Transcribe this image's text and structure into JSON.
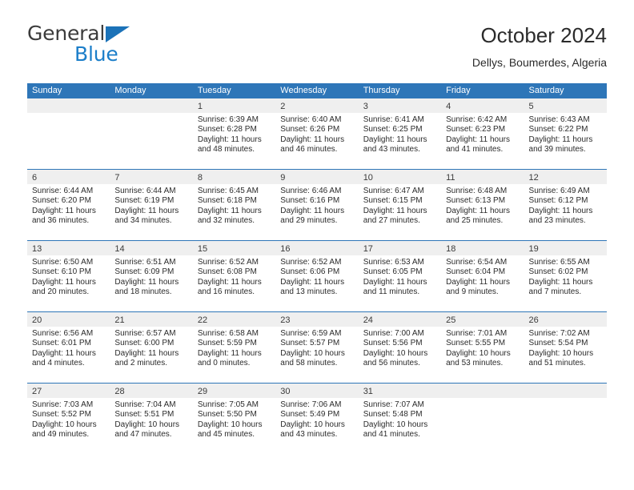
{
  "logo": {
    "word1": "General",
    "word2": "Blue",
    "triangle_icon": "logo-triangle-icon",
    "color_word1": "#3b3b3b",
    "color_word2": "#1b7ec9",
    "color_triangle": "#1b72b8"
  },
  "header": {
    "title": "October 2024",
    "subtitle": "Dellys, Boumerdes, Algeria"
  },
  "theme": {
    "header_blue": "#2e76b8",
    "day_band_gray": "#efefef",
    "text": "#2b2b2b"
  },
  "weekdays": [
    "Sunday",
    "Monday",
    "Tuesday",
    "Wednesday",
    "Thursday",
    "Friday",
    "Saturday"
  ],
  "weeks": [
    [
      {
        "day": "",
        "sunrise": "",
        "sunset": "",
        "daylight_line1": "",
        "daylight_line2": ""
      },
      {
        "day": "",
        "sunrise": "",
        "sunset": "",
        "daylight_line1": "",
        "daylight_line2": ""
      },
      {
        "day": "1",
        "sunrise": "Sunrise: 6:39 AM",
        "sunset": "Sunset: 6:28 PM",
        "daylight_line1": "Daylight: 11 hours",
        "daylight_line2": "and 48 minutes."
      },
      {
        "day": "2",
        "sunrise": "Sunrise: 6:40 AM",
        "sunset": "Sunset: 6:26 PM",
        "daylight_line1": "Daylight: 11 hours",
        "daylight_line2": "and 46 minutes."
      },
      {
        "day": "3",
        "sunrise": "Sunrise: 6:41 AM",
        "sunset": "Sunset: 6:25 PM",
        "daylight_line1": "Daylight: 11 hours",
        "daylight_line2": "and 43 minutes."
      },
      {
        "day": "4",
        "sunrise": "Sunrise: 6:42 AM",
        "sunset": "Sunset: 6:23 PM",
        "daylight_line1": "Daylight: 11 hours",
        "daylight_line2": "and 41 minutes."
      },
      {
        "day": "5",
        "sunrise": "Sunrise: 6:43 AM",
        "sunset": "Sunset: 6:22 PM",
        "daylight_line1": "Daylight: 11 hours",
        "daylight_line2": "and 39 minutes."
      }
    ],
    [
      {
        "day": "6",
        "sunrise": "Sunrise: 6:44 AM",
        "sunset": "Sunset: 6:20 PM",
        "daylight_line1": "Daylight: 11 hours",
        "daylight_line2": "and 36 minutes."
      },
      {
        "day": "7",
        "sunrise": "Sunrise: 6:44 AM",
        "sunset": "Sunset: 6:19 PM",
        "daylight_line1": "Daylight: 11 hours",
        "daylight_line2": "and 34 minutes."
      },
      {
        "day": "8",
        "sunrise": "Sunrise: 6:45 AM",
        "sunset": "Sunset: 6:18 PM",
        "daylight_line1": "Daylight: 11 hours",
        "daylight_line2": "and 32 minutes."
      },
      {
        "day": "9",
        "sunrise": "Sunrise: 6:46 AM",
        "sunset": "Sunset: 6:16 PM",
        "daylight_line1": "Daylight: 11 hours",
        "daylight_line2": "and 29 minutes."
      },
      {
        "day": "10",
        "sunrise": "Sunrise: 6:47 AM",
        "sunset": "Sunset: 6:15 PM",
        "daylight_line1": "Daylight: 11 hours",
        "daylight_line2": "and 27 minutes."
      },
      {
        "day": "11",
        "sunrise": "Sunrise: 6:48 AM",
        "sunset": "Sunset: 6:13 PM",
        "daylight_line1": "Daylight: 11 hours",
        "daylight_line2": "and 25 minutes."
      },
      {
        "day": "12",
        "sunrise": "Sunrise: 6:49 AM",
        "sunset": "Sunset: 6:12 PM",
        "daylight_line1": "Daylight: 11 hours",
        "daylight_line2": "and 23 minutes."
      }
    ],
    [
      {
        "day": "13",
        "sunrise": "Sunrise: 6:50 AM",
        "sunset": "Sunset: 6:10 PM",
        "daylight_line1": "Daylight: 11 hours",
        "daylight_line2": "and 20 minutes."
      },
      {
        "day": "14",
        "sunrise": "Sunrise: 6:51 AM",
        "sunset": "Sunset: 6:09 PM",
        "daylight_line1": "Daylight: 11 hours",
        "daylight_line2": "and 18 minutes."
      },
      {
        "day": "15",
        "sunrise": "Sunrise: 6:52 AM",
        "sunset": "Sunset: 6:08 PM",
        "daylight_line1": "Daylight: 11 hours",
        "daylight_line2": "and 16 minutes."
      },
      {
        "day": "16",
        "sunrise": "Sunrise: 6:52 AM",
        "sunset": "Sunset: 6:06 PM",
        "daylight_line1": "Daylight: 11 hours",
        "daylight_line2": "and 13 minutes."
      },
      {
        "day": "17",
        "sunrise": "Sunrise: 6:53 AM",
        "sunset": "Sunset: 6:05 PM",
        "daylight_line1": "Daylight: 11 hours",
        "daylight_line2": "and 11 minutes."
      },
      {
        "day": "18",
        "sunrise": "Sunrise: 6:54 AM",
        "sunset": "Sunset: 6:04 PM",
        "daylight_line1": "Daylight: 11 hours",
        "daylight_line2": "and 9 minutes."
      },
      {
        "day": "19",
        "sunrise": "Sunrise: 6:55 AM",
        "sunset": "Sunset: 6:02 PM",
        "daylight_line1": "Daylight: 11 hours",
        "daylight_line2": "and 7 minutes."
      }
    ],
    [
      {
        "day": "20",
        "sunrise": "Sunrise: 6:56 AM",
        "sunset": "Sunset: 6:01 PM",
        "daylight_line1": "Daylight: 11 hours",
        "daylight_line2": "and 4 minutes."
      },
      {
        "day": "21",
        "sunrise": "Sunrise: 6:57 AM",
        "sunset": "Sunset: 6:00 PM",
        "daylight_line1": "Daylight: 11 hours",
        "daylight_line2": "and 2 minutes."
      },
      {
        "day": "22",
        "sunrise": "Sunrise: 6:58 AM",
        "sunset": "Sunset: 5:59 PM",
        "daylight_line1": "Daylight: 11 hours",
        "daylight_line2": "and 0 minutes."
      },
      {
        "day": "23",
        "sunrise": "Sunrise: 6:59 AM",
        "sunset": "Sunset: 5:57 PM",
        "daylight_line1": "Daylight: 10 hours",
        "daylight_line2": "and 58 minutes."
      },
      {
        "day": "24",
        "sunrise": "Sunrise: 7:00 AM",
        "sunset": "Sunset: 5:56 PM",
        "daylight_line1": "Daylight: 10 hours",
        "daylight_line2": "and 56 minutes."
      },
      {
        "day": "25",
        "sunrise": "Sunrise: 7:01 AM",
        "sunset": "Sunset: 5:55 PM",
        "daylight_line1": "Daylight: 10 hours",
        "daylight_line2": "and 53 minutes."
      },
      {
        "day": "26",
        "sunrise": "Sunrise: 7:02 AM",
        "sunset": "Sunset: 5:54 PM",
        "daylight_line1": "Daylight: 10 hours",
        "daylight_line2": "and 51 minutes."
      }
    ],
    [
      {
        "day": "27",
        "sunrise": "Sunrise: 7:03 AM",
        "sunset": "Sunset: 5:52 PM",
        "daylight_line1": "Daylight: 10 hours",
        "daylight_line2": "and 49 minutes."
      },
      {
        "day": "28",
        "sunrise": "Sunrise: 7:04 AM",
        "sunset": "Sunset: 5:51 PM",
        "daylight_line1": "Daylight: 10 hours",
        "daylight_line2": "and 47 minutes."
      },
      {
        "day": "29",
        "sunrise": "Sunrise: 7:05 AM",
        "sunset": "Sunset: 5:50 PM",
        "daylight_line1": "Daylight: 10 hours",
        "daylight_line2": "and 45 minutes."
      },
      {
        "day": "30",
        "sunrise": "Sunrise: 7:06 AM",
        "sunset": "Sunset: 5:49 PM",
        "daylight_line1": "Daylight: 10 hours",
        "daylight_line2": "and 43 minutes."
      },
      {
        "day": "31",
        "sunrise": "Sunrise: 7:07 AM",
        "sunset": "Sunset: 5:48 PM",
        "daylight_line1": "Daylight: 10 hours",
        "daylight_line2": "and 41 minutes."
      },
      {
        "day": "",
        "sunrise": "",
        "sunset": "",
        "daylight_line1": "",
        "daylight_line2": ""
      },
      {
        "day": "",
        "sunrise": "",
        "sunset": "",
        "daylight_line1": "",
        "daylight_line2": ""
      }
    ]
  ]
}
